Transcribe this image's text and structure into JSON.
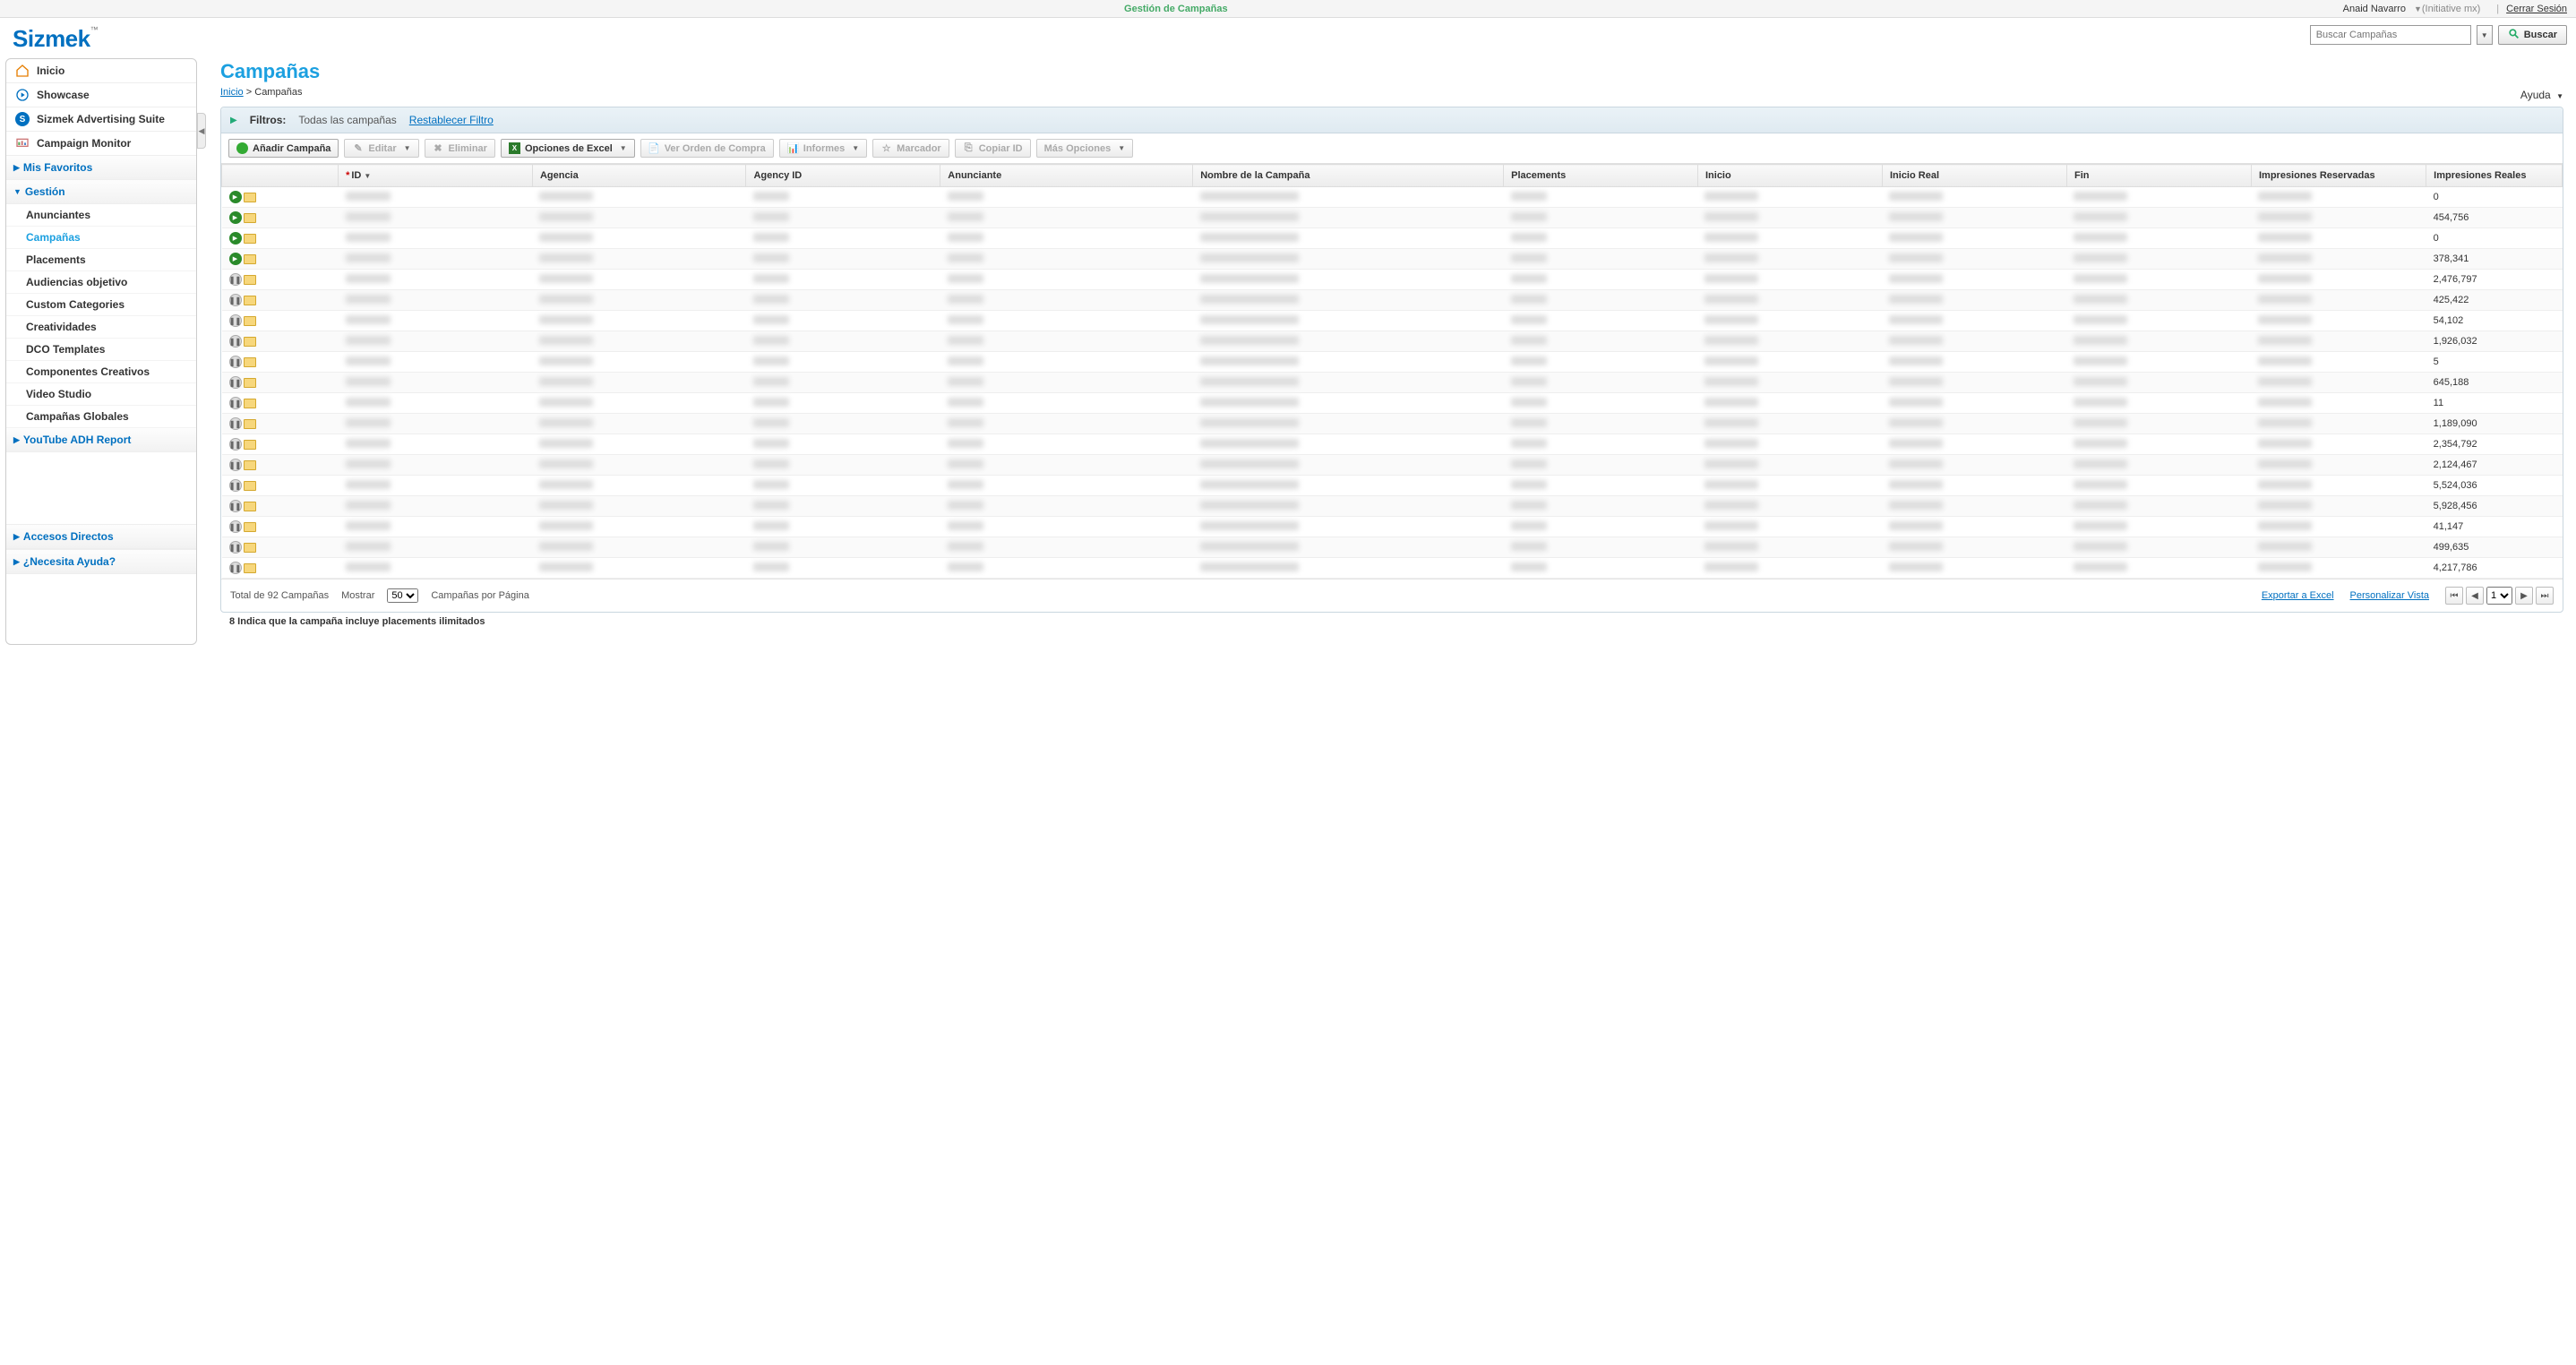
{
  "topbar": {
    "section": "Gestión de Campañas",
    "user": "Anaid Navarro",
    "org": "(Initiative mx)",
    "logout": "Cerrar Sesión"
  },
  "logo": {
    "brand": "Sizmek",
    "tm": "™"
  },
  "search": {
    "placeholder": "Buscar Campañas",
    "button": "Buscar"
  },
  "sidebar": {
    "top_items": [
      {
        "label": "Inicio",
        "icon": "home-icon"
      },
      {
        "label": "Showcase",
        "icon": "play-circle-icon"
      },
      {
        "label": "Sizmek Advertising Suite",
        "icon": "s-badge-icon"
      },
      {
        "label": "Campaign Monitor",
        "icon": "monitor-icon"
      }
    ],
    "sections": {
      "favoritos": {
        "label": "Mis Favoritos",
        "expanded": false
      },
      "gestion": {
        "label": "Gestión",
        "expanded": true,
        "items": [
          {
            "label": "Anunciantes"
          },
          {
            "label": "Campañas",
            "active": true
          },
          {
            "label": "Placements"
          },
          {
            "label": "Audiencias objetivo"
          },
          {
            "label": "Custom Categories"
          },
          {
            "label": "Creatividades"
          },
          {
            "label": "DCO Templates"
          },
          {
            "label": "Componentes Creativos"
          },
          {
            "label": "Video Studio"
          },
          {
            "label": "Campañas Globales"
          }
        ]
      },
      "youtube": {
        "label": "YouTube ADH Report",
        "expanded": false
      },
      "accesos": {
        "label": "Accesos Directos",
        "expanded": false
      },
      "ayuda": {
        "label": "¿Necesita Ayuda?",
        "expanded": false
      }
    }
  },
  "page": {
    "title": "Campañas",
    "breadcrumb_home": "Inicio",
    "breadcrumb_sep": ">",
    "breadcrumb_current": "Campañas",
    "help": "Ayuda"
  },
  "filters": {
    "label": "Filtros:",
    "value": "Todas las campañas",
    "reset": "Restablecer Filtro"
  },
  "toolbar": {
    "add": "Añadir Campaña",
    "edit": "Editar",
    "delete": "Eliminar",
    "excel": "Opciones de Excel",
    "order": "Ver Orden de Compra",
    "reports": "Informes",
    "bookmark": "Marcador",
    "copy_id": "Copiar ID",
    "more": "Más Opciones"
  },
  "table": {
    "columns": {
      "id": "ID",
      "agencia": "Agencia",
      "agency_id": "Agency ID",
      "anunciante": "Anunciante",
      "nombre": "Nombre de la Campaña",
      "placements": "Placements",
      "inicio": "Inicio",
      "inicio_real": "Inicio Real",
      "fin": "Fin",
      "imp_res": "Impresiones Reservadas",
      "imp_real": "Impresiones Reales"
    },
    "rows": [
      {
        "status": "play",
        "impresiones_reales": "0"
      },
      {
        "status": "play",
        "impresiones_reales": "454,756"
      },
      {
        "status": "play",
        "impresiones_reales": "0"
      },
      {
        "status": "play",
        "impresiones_reales": "378,341"
      },
      {
        "status": "pause",
        "impresiones_reales": "2,476,797"
      },
      {
        "status": "pause",
        "impresiones_reales": "425,422"
      },
      {
        "status": "pause",
        "impresiones_reales": "54,102"
      },
      {
        "status": "pause",
        "impresiones_reales": "1,926,032"
      },
      {
        "status": "pause",
        "impresiones_reales": "5"
      },
      {
        "status": "pause",
        "impresiones_reales": "645,188"
      },
      {
        "status": "pause",
        "impresiones_reales": "11"
      },
      {
        "status": "pause",
        "impresiones_reales": "1,189,090"
      },
      {
        "status": "pause",
        "impresiones_reales": "2,354,792"
      },
      {
        "status": "pause",
        "impresiones_reales": "2,124,467"
      },
      {
        "status": "pause",
        "impresiones_reales": "5,524,036"
      },
      {
        "status": "pause",
        "impresiones_reales": "5,928,456"
      },
      {
        "status": "pause",
        "impresiones_reales": "41,147"
      },
      {
        "status": "pause",
        "impresiones_reales": "499,635"
      },
      {
        "status": "pause",
        "impresiones_reales": "4,217,786"
      }
    ]
  },
  "footer": {
    "total": "Total de 92 Campañas",
    "show_label": "Mostrar",
    "page_size": "50",
    "per_page": "Campañas por Página",
    "export": "Exportar a Excel",
    "customize": "Personalizar Vista",
    "page_current": "1",
    "note": "8 Indica que la campaña incluye placements ilimitados"
  }
}
